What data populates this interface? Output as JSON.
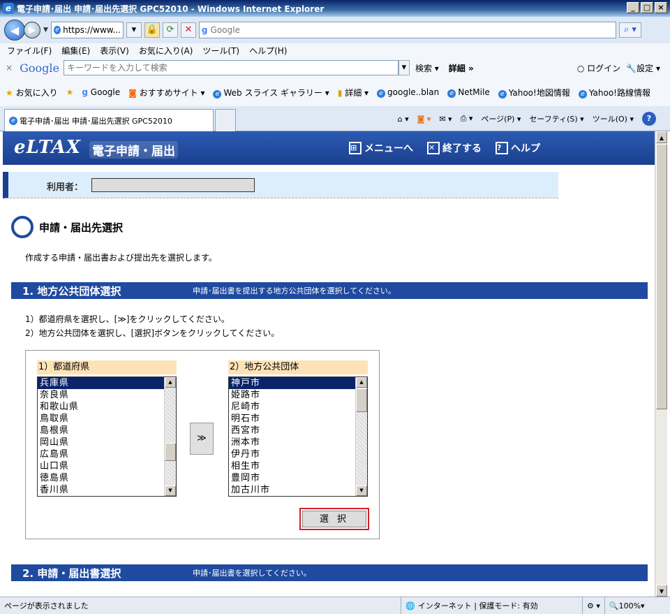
{
  "window": {
    "title": "電子申請･届出 申請･届出先選択 GPC52010 - Windows Internet Explorer"
  },
  "nav": {
    "address": "https://www...",
    "search_engine": "Google"
  },
  "menu": [
    "ファイル(F)",
    "編集(E)",
    "表示(V)",
    "お気に入り(A)",
    "ツール(T)",
    "ヘルプ(H)"
  ],
  "google_bar": {
    "logo": "Google",
    "placeholder": "キーワードを入力して検索",
    "search_label": "検索",
    "details": "詳細 »",
    "login": "ログイン",
    "settings": "設定"
  },
  "favorites": {
    "label": "お気に入り",
    "items": [
      "Google",
      "おすすめサイト",
      "Web スライス ギャラリー",
      "詳細",
      "google..blan",
      "NetMile",
      "Yahoo!地図情報",
      "Yahoo!路線情報"
    ]
  },
  "tab": {
    "label": "電子申請･届出 申請･届出先選択 GPC52010"
  },
  "commands": [
    "ページ(P)",
    "セーフティ(S)",
    "ツール(O)"
  ],
  "header": {
    "logo": "eLTAX",
    "subtitle": "電子申請・届出",
    "links": [
      "メニューへ",
      "終了する",
      "ヘルプ"
    ]
  },
  "user": {
    "label": "利用者："
  },
  "page": {
    "title": "申請・届出先選択",
    "description": "作成する申請・届出書および提出先を選択します。"
  },
  "section1": {
    "title": "1. 地方公共団体選択",
    "desc": "申請･届出書を提出する地方公共団体を選択してください。",
    "step1": "1）都道府県を選択し、[≫]をクリックしてください。",
    "step2": "2）地方公共団体を選択し、[選択]ボタンをクリックしてください。"
  },
  "prefectures": {
    "header": "1）都道府県",
    "items": [
      "兵庫県",
      "奈良県",
      "和歌山県",
      "鳥取県",
      "島根県",
      "岡山県",
      "広島県",
      "山口県",
      "徳島県",
      "香川県"
    ],
    "selected": "兵庫県"
  },
  "move_button": "≫",
  "municipalities": {
    "header": "2）地方公共団体",
    "items": [
      "神戸市",
      "姫路市",
      "尼崎市",
      "明石市",
      "西宮市",
      "洲本市",
      "伊丹市",
      "相生市",
      "豊岡市",
      "加古川市"
    ],
    "selected": "神戸市"
  },
  "select_button": "選 択",
  "section2": {
    "title": "2. 申請・届出書選択",
    "desc": "申請･届出書を選択してください。"
  },
  "status": {
    "message": "ページが表示されました",
    "zone": "インターネット | 保護モード: 有効",
    "zoom": "100%"
  }
}
